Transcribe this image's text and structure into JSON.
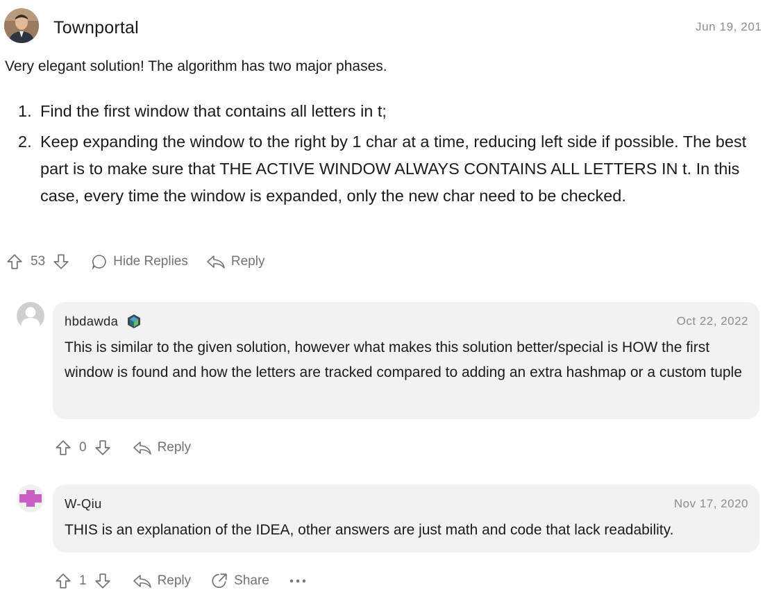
{
  "post": {
    "author": "Townportal",
    "date": "Jun 19, 201",
    "intro": "Very elegant solution! The algorithm has two major phases.",
    "steps": [
      {
        "num": "1.",
        "text": "Find the first window that contains all letters in t;"
      },
      {
        "num": "2.",
        "text": "Keep expanding the window to the right by 1 char at a time, reducing left side if possible. The best part is to make sure that THE ACTIVE WINDOW ALWAYS CONTAINS ALL LETTERS IN t. In this case, every time the window is expanded, only the new char need to be checked."
      }
    ],
    "votes": "53",
    "hide_replies_label": "Hide Replies",
    "reply_label": "Reply"
  },
  "replies": [
    {
      "username": "hbdawda",
      "date": "Oct 22, 2022",
      "text": "This is similar to the given solution, however what makes this solution better/special is HOW the first window is found and how the letters are tracked compared to adding an extra hashmap or a custom tuple",
      "votes": "0",
      "reply_label": "Reply"
    },
    {
      "username": "W-Qiu",
      "date": "Nov 17, 2020",
      "text": "THIS is an explanation of the IDEA, other answers are just math and code that lack readability.",
      "votes": "1",
      "reply_label": "Reply",
      "share_label": "Share"
    }
  ],
  "icons": {
    "upvote": "arrow-up-icon",
    "downvote": "arrow-down-icon",
    "comment": "comment-bubble-icon",
    "reply": "reply-arrow-icon",
    "share": "share-icon",
    "more": "more-dots-icon",
    "badge": "level-badge-icon"
  },
  "colors": {
    "text": "#1a1a1a",
    "muted": "#737373",
    "bubble_bg": "#f2f2f2",
    "wqiu_avatar": "#c95fc4"
  }
}
